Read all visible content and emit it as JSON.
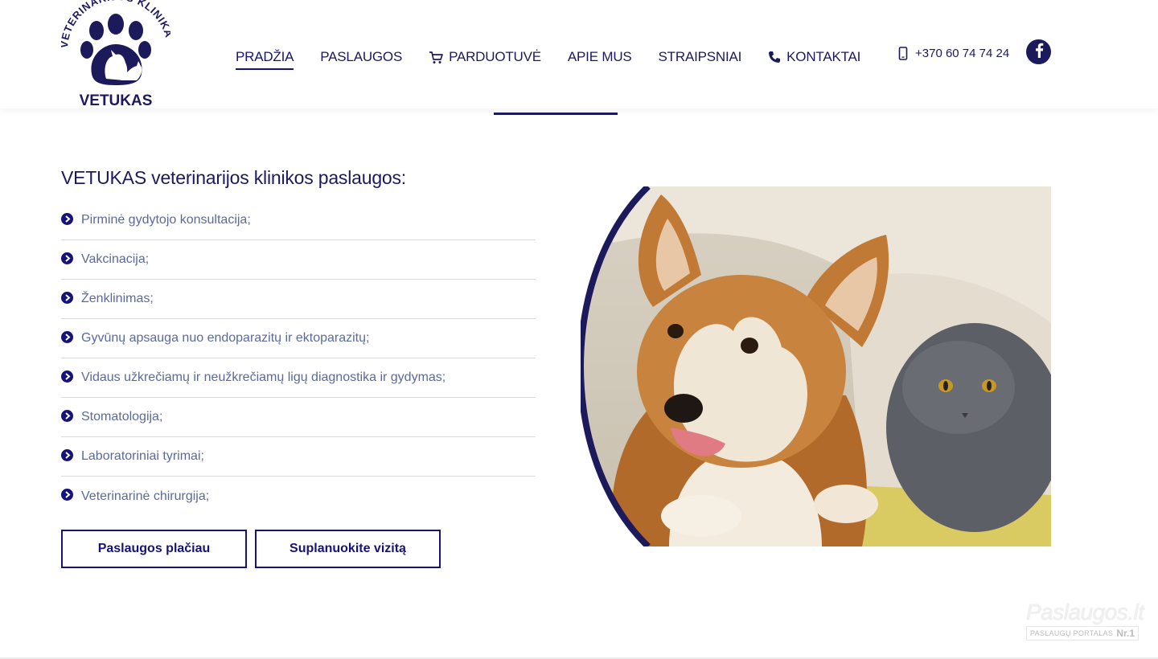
{
  "brand": {
    "logo_arc_text": "VETERINARIJOS KLINIKA",
    "logo_name": "VETUKAS",
    "primary_color": "#1d1a5c",
    "accent_color": "#15127a"
  },
  "nav": {
    "items": [
      {
        "label": "PRADŽIA",
        "active": true,
        "icon": ""
      },
      {
        "label": "PASLAUGOS",
        "active": false,
        "icon": ""
      },
      {
        "label": "PARDUOTUVĖ",
        "active": false,
        "icon": "cart-icon"
      },
      {
        "label": "APIE MUS",
        "active": false,
        "icon": ""
      },
      {
        "label": "STRAIPSNIAI",
        "active": false,
        "icon": ""
      },
      {
        "label": "KONTAKTAI",
        "active": false,
        "icon": "phone-handset-icon"
      }
    ]
  },
  "header": {
    "phone": "+370 60 74 74 24",
    "phone_icon": "mobile-phone-icon",
    "social_icon": "facebook-icon"
  },
  "main": {
    "title": "VETUKAS veterinarijos klinikos paslaugos:",
    "services": [
      "Pirminė gydytojo konsultacija;",
      "Vakcinacija;",
      "Ženklinimas;",
      "Gyvūnų apsauga nuo endoparazitų ir ektoparazitų;",
      "Vidaus užkrečiamų ir neužkrečiamų ligų diagnostika ir gydymas;",
      "Stomatologija;",
      "Laboratoriniai tyrimai;",
      "Veterinarinė chirurgija;"
    ],
    "buttons": {
      "more": "Paslaugos plačiau",
      "book": "Suplanuokite vizitą"
    },
    "bullet_icon": "chevron-right-circle-icon"
  },
  "watermark": {
    "title": "Paslaugos.lt",
    "subtitle": "PASLAUGŲ PORTALAS",
    "badge": "Nr.1"
  }
}
